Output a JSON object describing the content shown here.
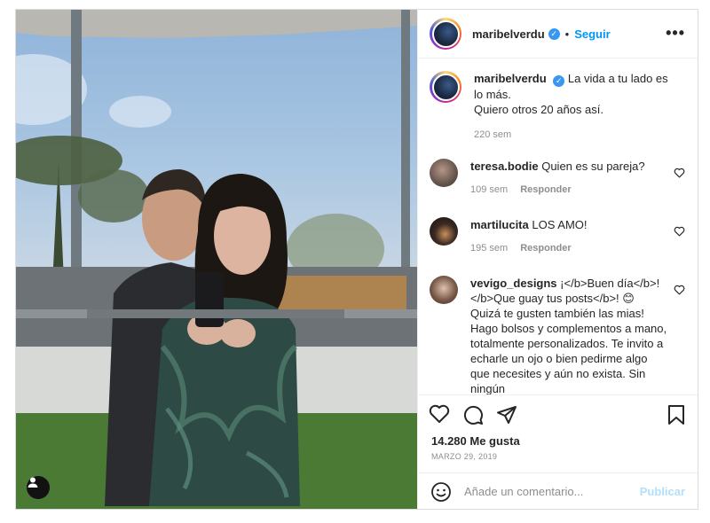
{
  "post": {
    "photo": {
      "alt": ""
    },
    "header": {
      "username": "maribelverdu",
      "dot": "•",
      "follow_label": "Seguir",
      "more_label": "•••"
    },
    "caption": {
      "username": "maribelverdu",
      "text_line1": "La vida a tu lado es lo más.",
      "text_line2": "Quiero otros 20 años así.",
      "time": "220 sem"
    },
    "comments": [
      {
        "username": "teresa.bodie",
        "text": "Quien es su pareja?",
        "time": "109 sem",
        "reply_label": "Responder",
        "avatar_color": "#6b5a52"
      },
      {
        "username": "martilucita",
        "text": "LOS AMO!",
        "time": "195 sem",
        "reply_label": "Responder",
        "avatar_color": "#3a2a22"
      },
      {
        "username": "vevigo_designs",
        "text": "¡</b>Buen día</b>! </b>Que guay tus posts</b>! 😊 Quizá te gusten también las mias! Hago bolsos y complementos a mano, totalmente personalizados. Te invito a echarle un ojo o bien pedirme algo que necesites y aún no exista. Sin ningún",
        "avatar_color": "#7a5a4a"
      }
    ],
    "actions": {
      "likes": "14.280 Me gusta",
      "date": "MARZO 29, 2019"
    },
    "add_comment": {
      "placeholder": "Añade un comentario...",
      "publish_label": "Publicar"
    },
    "colors": {
      "accent": "#0095f6",
      "publish_disabled": "#b2dffc",
      "verified": "#3897f0"
    },
    "icons": [
      "verified-icon",
      "more-icon",
      "heart-icon",
      "comment-icon",
      "share-icon",
      "save-icon",
      "emoji-icon",
      "user-tag-icon"
    ]
  }
}
